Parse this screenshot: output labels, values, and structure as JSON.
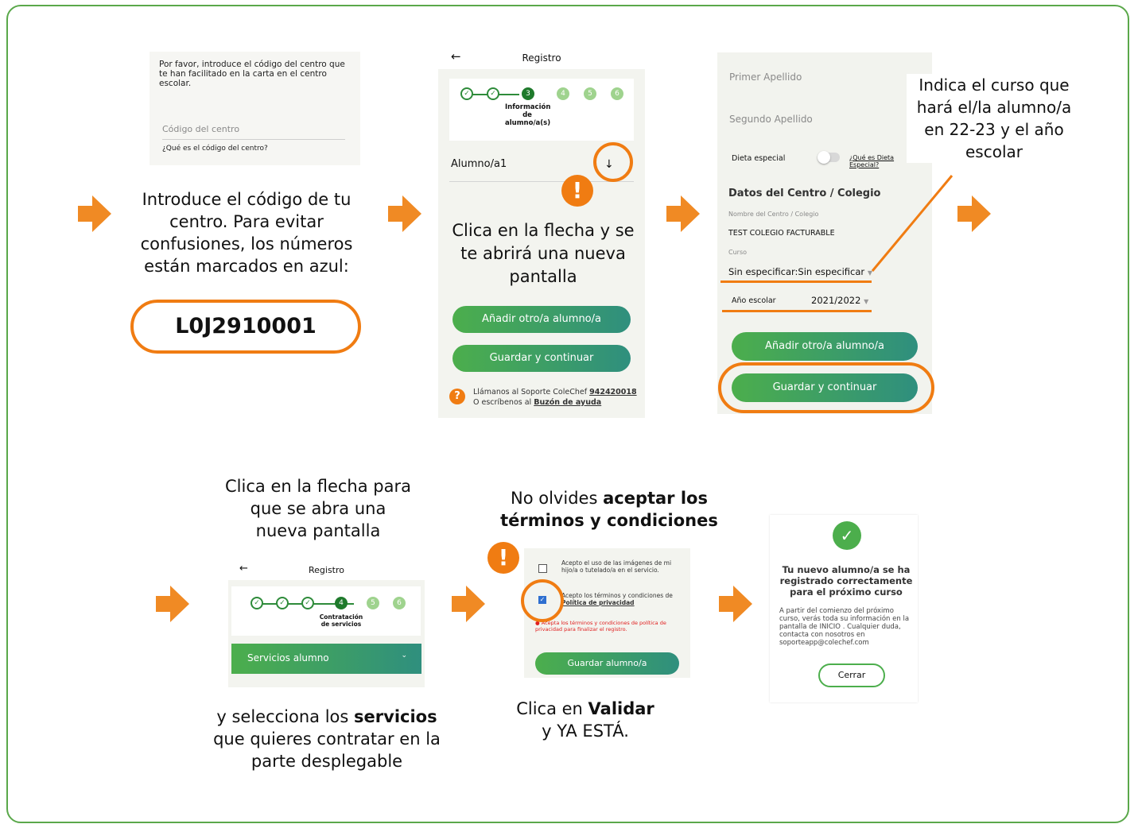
{
  "step1": {
    "screen_text": "Por favor, introduce el código del centro que te han facilitado en la carta en el centro escolar.",
    "field_placeholder": "Código del centro",
    "help_link": "¿Qué es el código del centro?",
    "caption": "Introduce el código de tu centro. Para evitar confusiones, los números están marcados en azul:",
    "code": "L0J2910001"
  },
  "step2": {
    "header_title": "Registro",
    "back_icon": "arrow-left-icon",
    "steps": [
      "✓",
      "✓",
      "3",
      "4",
      "5",
      "6"
    ],
    "current_step_label": "Información de alumno/a(s)",
    "student_label": "Alumno/a1",
    "caption": "Clica en la flecha y se te abrirá una nueva pantalla",
    "add_button": "Añadir otro/a alumno/a",
    "save_button": "Guardar y continuar",
    "support_text": "Llámanos al Soporte ColeChef",
    "support_phone": "942420018",
    "support_text2": "O escríbenos al",
    "support_link": "Buzón de ayuda"
  },
  "step3": {
    "field1": "Primer Apellido",
    "field2": "Segundo Apellido",
    "diet_label": "Dieta especial",
    "diet_link": "¿Qué es Dieta Especial?",
    "section_title": "Datos del Centro / Colegio",
    "school_label": "Nombre del Centro / Colegio",
    "school_value": "TEST COLEGIO FACTURABLE",
    "course_label": "Curso",
    "course_value": "Sin especificar:Sin especificar",
    "year_label": "Año escolar",
    "year_value": "2021/2022",
    "add_button": "Añadir otro/a alumno/a",
    "save_button": "Guardar y continuar",
    "caption": "Indica el curso que hará el/la alumno/a en 22-23 y el año escolar"
  },
  "step4": {
    "caption_top": "Clica en la flecha para que se abra una nueva pantalla",
    "header_title": "Registro",
    "steps": [
      "✓",
      "✓",
      "✓",
      "4",
      "5",
      "6"
    ],
    "current_step_label": "Contratación de servicios",
    "services_label": "Servicios alumno",
    "caption_bottom_a": "y selecciona los",
    "caption_bottom_bold": "servicios",
    "caption_bottom_b": "que quieres contratar en la parte desplegable"
  },
  "step5": {
    "caption_top_a": "No olvides",
    "caption_top_bold": "aceptar los términos y condiciones",
    "check1_text": "Acepto el uso de las imágenes de mi hijo/a o tutelado/a en el servicio.",
    "check2_text": "Acepto los términos y condiciones de",
    "check2_link": "Política de privacidad",
    "error_text": "Acepta los términos y condiciones de política de privacidad para finalizar el registro.",
    "save_button": "Guardar alumno/a",
    "caption_bottom_a": "Clica en",
    "caption_bottom_bold": "Validar",
    "caption_bottom_b": "y YA ESTÁ."
  },
  "step6": {
    "title": "Tu nuevo alumno/a se ha registrado correctamente para el próximo curso",
    "body": "A partir del comienzo del próximo curso, verás toda su información en la pantalla de INICIO . Cualquier duda, contacta con nosotros en soporteapp@colechef.com",
    "close_button": "Cerrar"
  },
  "colors": {
    "accent": "#f07c12",
    "frame": "#5aa84a",
    "green_start": "#4cae4c",
    "green_end": "#2f8f7e"
  }
}
